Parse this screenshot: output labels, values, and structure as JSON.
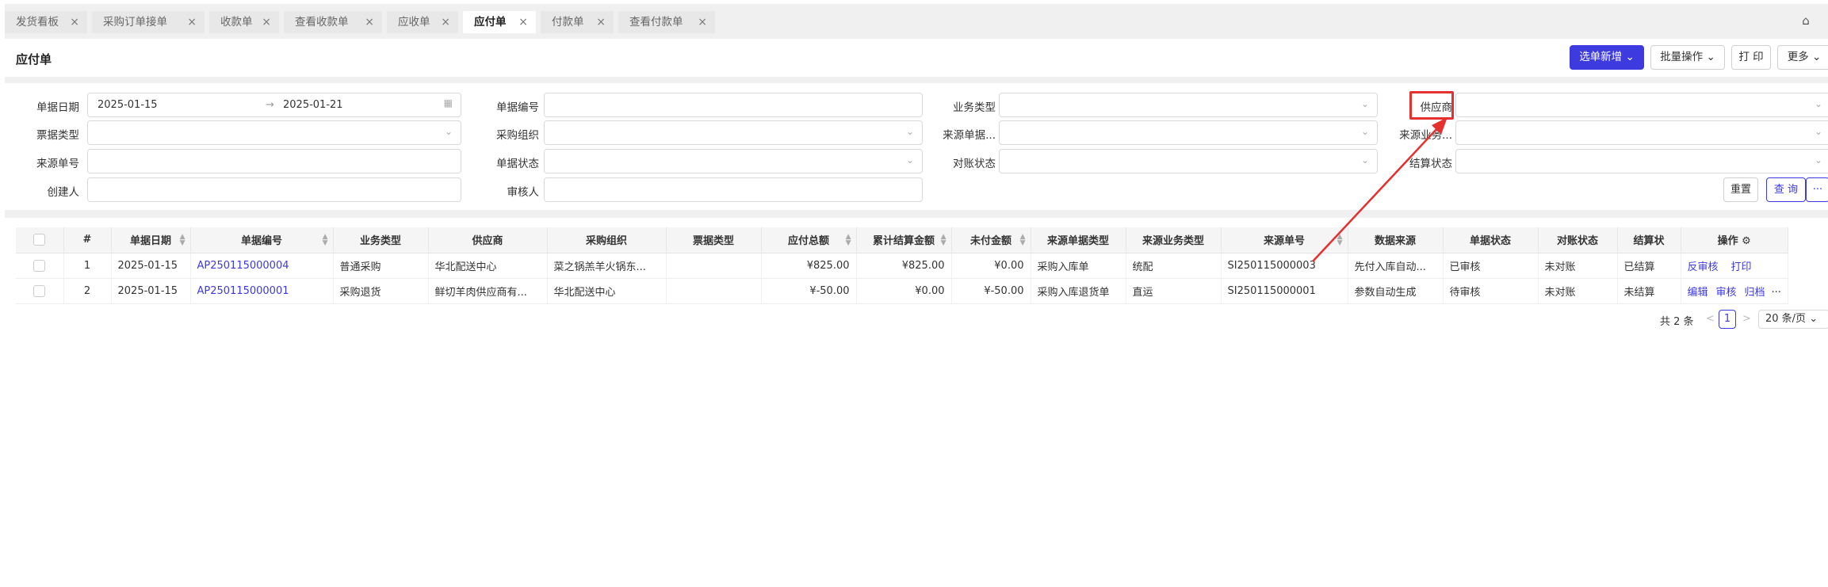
{
  "tabs": [
    {
      "label": "发货看板",
      "active": false
    },
    {
      "label": "采购订单接单",
      "active": false
    },
    {
      "label": "收款单",
      "active": false
    },
    {
      "label": "查看收款单",
      "active": false
    },
    {
      "label": "应收单",
      "active": false
    },
    {
      "label": "应付单",
      "active": true
    },
    {
      "label": "付款单",
      "active": false
    },
    {
      "label": "查看付款单",
      "active": false
    }
  ],
  "tab_close": "×",
  "header": {
    "title": "应付单",
    "buttons": {
      "new": "选单新增",
      "batch": "批量操作",
      "print": "打 印",
      "more": "更多"
    }
  },
  "filters": {
    "doc_date": {
      "label": "单据日期",
      "start": "2025-01-15",
      "end": "2025-01-21",
      "sep": "→"
    },
    "doc_no": {
      "label": "单据编号"
    },
    "biz_type": {
      "label": "业务类型"
    },
    "supplier": {
      "label": "供应商"
    },
    "invoice_type": {
      "label": "票据类型"
    },
    "purchase_org": {
      "label": "采购组织"
    },
    "source_doc_type": {
      "label": "来源单据..."
    },
    "source_biz": {
      "label": "来源业务..."
    },
    "source_no": {
      "label": "来源单号"
    },
    "doc_status": {
      "label": "单据状态"
    },
    "recon_status": {
      "label": "对账状态"
    },
    "settle_status": {
      "label": "结算状态"
    },
    "creator": {
      "label": "创建人"
    },
    "auditor": {
      "label": "审核人"
    },
    "reset_label": "重置",
    "query_label": "查 询",
    "more_label": "···"
  },
  "table": {
    "headers": [
      "#",
      "单据日期",
      "单据编号",
      "业务类型",
      "供应商",
      "采购组织",
      "票据类型",
      "应付总额",
      "累计结算金额",
      "未付金额",
      "来源单据类型",
      "来源业务类型",
      "来源单号",
      "数据来源",
      "单据状态",
      "对账状态",
      "结算状",
      "操作"
    ],
    "rows": [
      {
        "idx": "1",
        "date": "2025-01-15",
        "doc_no": "AP250115000004",
        "biz_type": "普通采购",
        "supplier": "华北配送中心",
        "org": "菜之锅羔羊火锅东...",
        "invoice_type": "",
        "total": "¥825.00",
        "settled": "¥825.00",
        "unpaid": "¥0.00",
        "src_type": "采购入库单",
        "src_biz": "统配",
        "src_no": "SI250115000003",
        "data_src": "先付入库自动...",
        "status": "已审核",
        "recon": "未对账",
        "settle": "已结算",
        "actions": [
          "反审核",
          "打印"
        ]
      },
      {
        "idx": "2",
        "date": "2025-01-15",
        "doc_no": "AP250115000001",
        "biz_type": "采购退货",
        "supplier": "鲜切羊肉供应商有...",
        "org": "华北配送中心",
        "invoice_type": "",
        "total": "¥-50.00",
        "settled": "¥0.00",
        "unpaid": "¥-50.00",
        "src_type": "采购入库退货单",
        "src_biz": "直运",
        "src_no": "SI250115000001",
        "data_src": "参数自动生成",
        "status": "待审核",
        "recon": "未对账",
        "settle": "未结算",
        "actions": [
          "编辑",
          "审核",
          "归档",
          "···"
        ]
      }
    ]
  },
  "pagination": {
    "total_text": "共 2 条",
    "prev": "<",
    "current": "1",
    "next": ">",
    "page_size": "20 条/页"
  },
  "colors": {
    "primary": "#3d3ae0",
    "annotation": "#e53030"
  }
}
